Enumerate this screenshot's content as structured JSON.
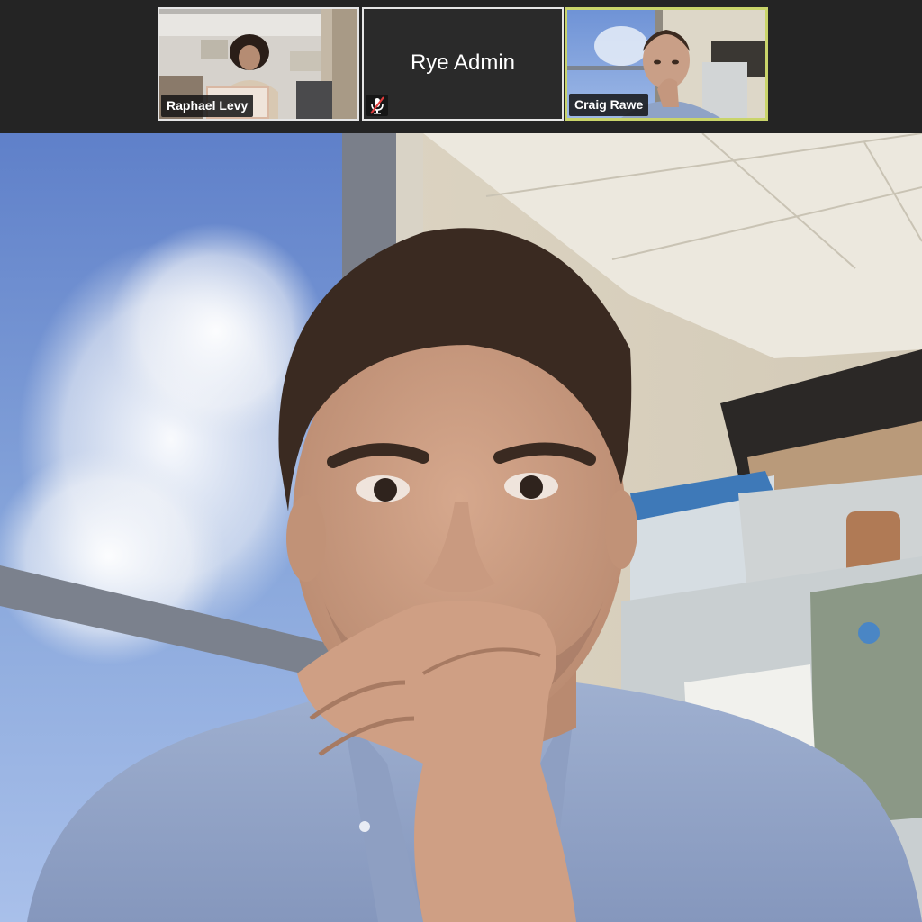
{
  "participants": [
    {
      "name": "Raphael Levy",
      "video_on": true
    },
    {
      "name": "Rye Admin",
      "video_on": false,
      "muted": true
    },
    {
      "name": "Craig Rawe",
      "video_on": true,
      "active_speaker": true
    }
  ],
  "main_view": {
    "speaker": "Craig Rawe"
  },
  "icons": {
    "mute": "microphone-muted-icon"
  },
  "colors": {
    "strip_background": "#242424",
    "active_speaker_border": "#c9d46a",
    "tile_border": "#e6e6e6",
    "label_background": "#141414",
    "mute_slash": "#e03c3c"
  }
}
